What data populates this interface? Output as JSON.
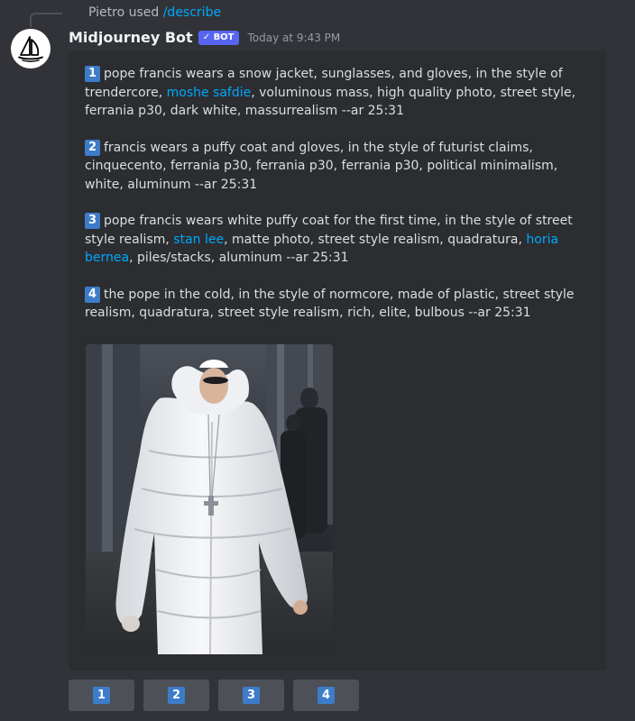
{
  "reply": {
    "user": "Pietro used",
    "command": "/describe"
  },
  "author": {
    "name": "Midjourney Bot",
    "badge": "✓ BOT",
    "timestamp": "Today at 9:43 PM"
  },
  "prompts": [
    {
      "number": "1",
      "text_before": "pope francis wears a snow jacket, sunglasses, and gloves, in the style of trendercore, ",
      "link1": "moshe safdie",
      "text_middle": ", voluminous mass, high quality photo, street style, ferrania p30, dark white, massurrealism --ar 25:31",
      "link2": "",
      "text_after": ""
    },
    {
      "number": "2",
      "text_before": "francis wears a puffy coat and gloves, in the style of futurist claims, cinquecento, ferrania p30, ferrania p30, ferrania p30, political minimalism, white, aluminum --ar 25:31",
      "link1": "",
      "text_middle": "",
      "link2": "",
      "text_after": ""
    },
    {
      "number": "3",
      "text_before": "pope francis wears white puffy coat for the first time, in the style of street style realism, ",
      "link1": "stan lee",
      "text_middle": ", matte photo, street style realism, quadratura, ",
      "link2": "horia bernea",
      "text_after": ", piles/stacks, aluminum --ar 25:31"
    },
    {
      "number": "4",
      "text_before": "the pope in the cold, in the style of normcore, made of plastic, street style realism, quadratura, street style realism, rich, elite, bulbous --ar 25:31",
      "link1": "",
      "text_middle": "",
      "link2": "",
      "text_after": ""
    }
  ],
  "buttons": [
    "1",
    "2",
    "3",
    "4"
  ],
  "colors": {
    "background": "#313338",
    "embed": "#2b2d31",
    "link": "#00a8fc",
    "number_badge": "#3d7cc9",
    "button": "#4e5058",
    "bot_badge": "#5865f2"
  },
  "icons": {
    "avatar": "sailboat-logo-icon"
  }
}
